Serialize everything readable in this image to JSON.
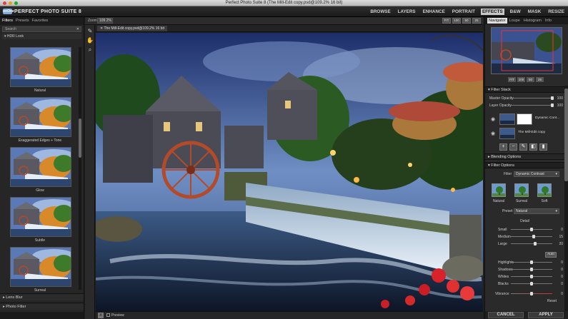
{
  "window": {
    "title": "Perfect Photo Suite 8 (The Mill-Edit copy.psd@109.2% 16 bit)"
  },
  "app": {
    "logo_mark": "onOne",
    "logo_text": "PERFECT PHOTO SUITE 8"
  },
  "modules": [
    {
      "label": "BROWSE",
      "active": false
    },
    {
      "label": "LAYERS",
      "active": false
    },
    {
      "label": "ENHANCE",
      "active": false
    },
    {
      "label": "PORTRAIT",
      "active": false
    },
    {
      "label": "EFFECTS",
      "active": true
    },
    {
      "label": "B&W",
      "active": false
    },
    {
      "label": "MASK",
      "active": false
    },
    {
      "label": "RESIZE",
      "active": false
    }
  ],
  "left_panel": {
    "tabs": [
      "Filters",
      "Presets",
      "Favorites"
    ],
    "search_placeholder": "Search",
    "search_clear": "✕",
    "category_open": "▾ HDR Look",
    "thumbnails": [
      "Natural",
      "Exaggerated Edges + Tone",
      "Glow",
      "Subtle",
      "Surreal"
    ],
    "categories_collapsed": [
      "▸ Lens Blur",
      "▸ Photo Filter"
    ]
  },
  "canvas": {
    "zoom_label": "Zoom",
    "zoom_value": "109.2%",
    "zoom_buttons": [
      "FIT",
      "100",
      "50",
      "25"
    ],
    "doc_tab": "✕  The Mill-Edit copy.psd@109.2% 16 bit",
    "preview_label": "Preview"
  },
  "right_panel": {
    "tabs": [
      "Navigator",
      "Loupe",
      "Histogram",
      "Info"
    ],
    "nav_buttons": [
      "FIT",
      "100",
      "50",
      "25"
    ],
    "filter_stack": {
      "title": "▾ Filter Stack",
      "sliders": [
        {
          "label": "Master Opacity",
          "value": "100",
          "pos": 1.0
        },
        {
          "label": "Layer Opacity",
          "value": "100",
          "pos": 1.0
        }
      ],
      "layers": [
        "Dynamic Cont...",
        "The Mill-Edit copy"
      ],
      "blending": "▸ Blending Options"
    },
    "filter_options": {
      "title": "▾ Filter Options",
      "filter_label": "Filter",
      "filter_value": "Dynamic Contrast",
      "presets": [
        "Natural",
        "Surreal",
        "Soft"
      ],
      "preset_label": "Preset",
      "preset_value": "Natural",
      "detail_title": "Detail",
      "detail": [
        {
          "label": "Small",
          "value": "0",
          "pos": 0.5
        },
        {
          "label": "Medium",
          "value": "15",
          "pos": 0.56
        },
        {
          "label": "Large",
          "value": "20",
          "pos": 0.58
        }
      ],
      "auto_label": "Auto",
      "tone": [
        {
          "label": "Highlights",
          "value": "0",
          "pos": 0.5
        },
        {
          "label": "Shadows",
          "value": "0",
          "pos": 0.5
        },
        {
          "label": "Whites",
          "value": "0",
          "pos": 0.5
        },
        {
          "label": "Blacks",
          "value": "0",
          "pos": 0.5
        }
      ],
      "vibrance": {
        "label": "Vibrance",
        "value": "0",
        "pos": 0.5
      },
      "reset_label": "Reset"
    },
    "cancel_label": "CANCEL",
    "apply_label": "APPLY"
  }
}
